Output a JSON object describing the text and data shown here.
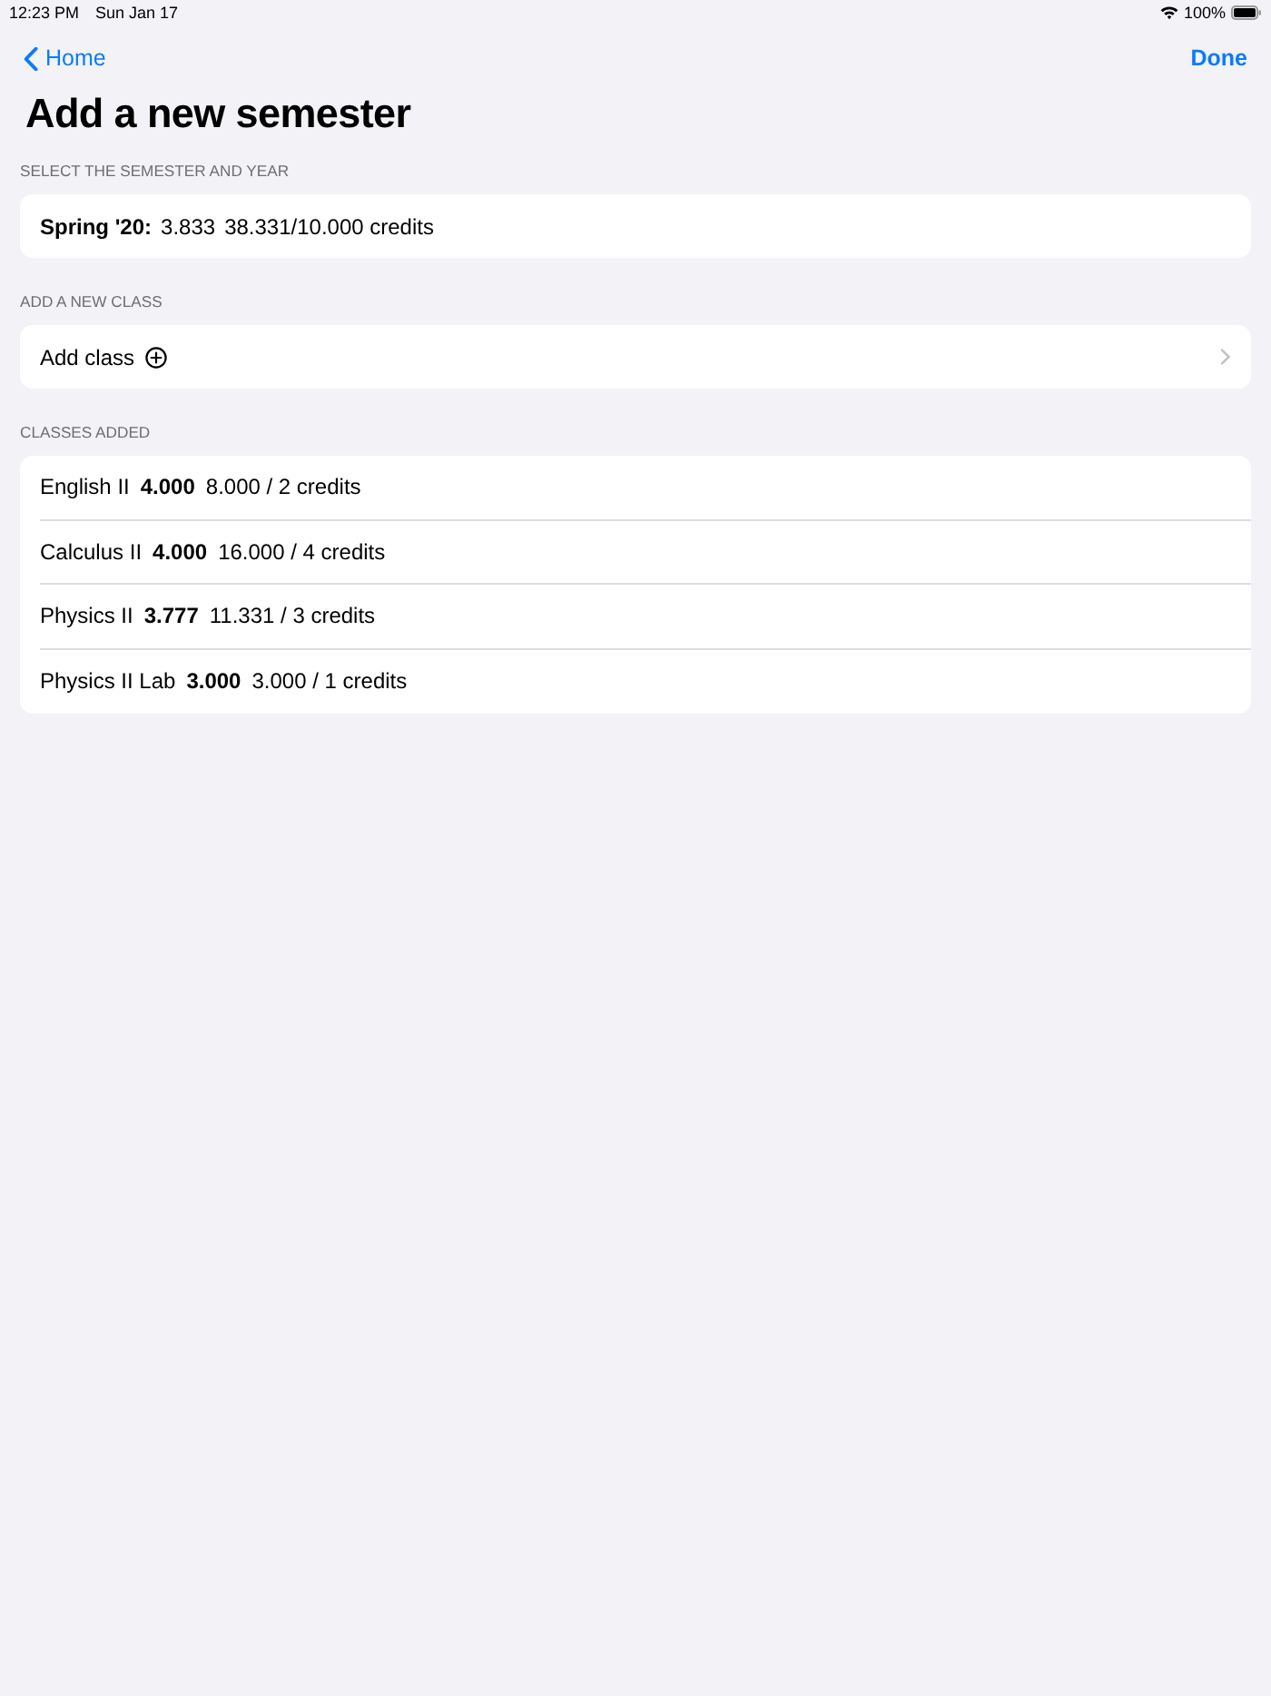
{
  "status_bar": {
    "time": "12:23 PM",
    "date": "Sun Jan 17",
    "battery": "100%"
  },
  "nav": {
    "back": "Home",
    "done": "Done"
  },
  "title": "Add a new semester",
  "semester_section": {
    "header": "SELECT THE SEMESTER AND YEAR",
    "term": "Spring '20:",
    "gpa": "3.833",
    "credits": "38.331/10.000 credits"
  },
  "add_section": {
    "header": "ADD A NEW CLASS",
    "label": "Add class"
  },
  "classes_section": {
    "header": "CLASSES ADDED",
    "rows": [
      {
        "name": "English II",
        "grade": "4.000",
        "credits": "8.000 / 2 credits"
      },
      {
        "name": "Calculus II",
        "grade": "4.000",
        "credits": "16.000 / 4 credits"
      },
      {
        "name": "Physics II",
        "grade": "3.777",
        "credits": "11.331 / 3 credits"
      },
      {
        "name": "Physics II Lab",
        "grade": "3.000",
        "credits": "3.000 / 1 credits"
      }
    ]
  }
}
